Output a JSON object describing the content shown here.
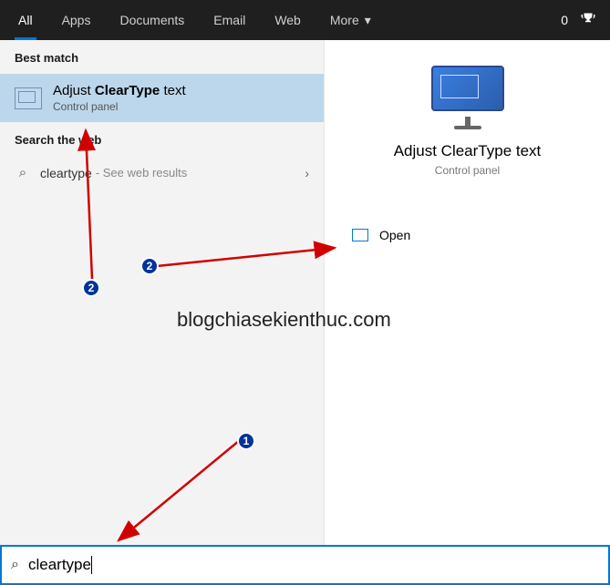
{
  "topbar": {
    "tabs": [
      "All",
      "Apps",
      "Documents",
      "Email",
      "Web",
      "More"
    ],
    "active": 0,
    "count": "0"
  },
  "left": {
    "best_match_label": "Best match",
    "result": {
      "pre": "Adjust ",
      "bold": "ClearType",
      "post": " text",
      "sub": "Control panel"
    },
    "web_label": "Search the web",
    "web_item": {
      "term": "cleartype",
      "suffix": "- See web results"
    }
  },
  "right": {
    "title": "Adjust ClearType text",
    "sub": "Control panel",
    "open": "Open"
  },
  "search": {
    "value": "cleartype"
  },
  "watermark": "blogchiasekienthuc.com",
  "badges": {
    "a": "1",
    "b": "2",
    "c": "2"
  }
}
